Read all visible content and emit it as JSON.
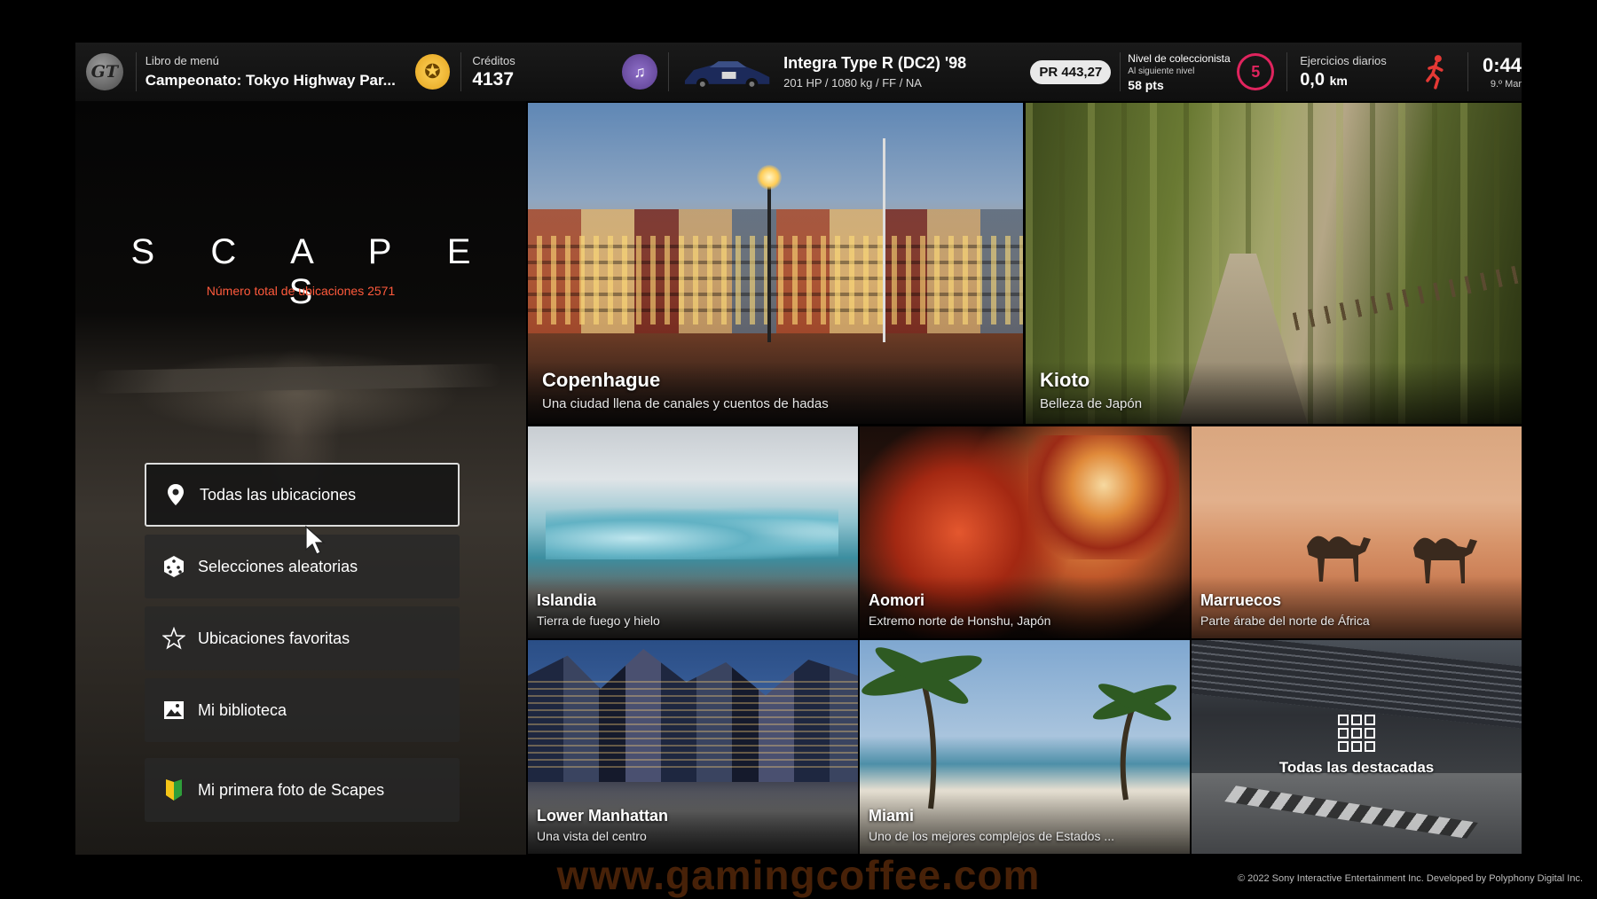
{
  "topbar": {
    "menu_label": "Libro de menú",
    "menu_value": "Campeonato: Tokyo Highway Par...",
    "credits_label": "Créditos",
    "credits_value": "4137",
    "car_name": "Integra Type R (DC2) '98",
    "car_specs": "201 HP / 1080 kg / FF / NA",
    "pr": "PR 443,27",
    "collector_label": "Nivel de coleccionista",
    "collector_sub": "Al siguiente nivel",
    "collector_pts": "58 pts",
    "collector_level": "5",
    "daily_label": "Ejercicios diarios",
    "daily_value": "0,0",
    "daily_unit": "km",
    "time": "0:44",
    "date": "9.º Mar",
    "colors": {
      "credits_icon": "#f2b632",
      "music_icon": "#7a5bb5",
      "level_ring": "#e0245e",
      "runner": "#e53935"
    }
  },
  "left": {
    "title": "S C A P E S",
    "count_label": "Número total de ubicaciones  2571",
    "accent": "#ff5a3c",
    "menu": [
      {
        "label": "Todas las ubicaciones",
        "icon": "location-pin-icon"
      },
      {
        "label": "Selecciones aleatorias",
        "icon": "dice-icon"
      },
      {
        "label": "Ubicaciones favoritas",
        "icon": "star-icon"
      },
      {
        "label": "Mi biblioteca",
        "icon": "image-icon"
      },
      {
        "label": "Mi primera foto de Scapes",
        "icon": "beginner-leaf-icon"
      }
    ]
  },
  "tiles": {
    "copenhagen": {
      "title": "Copenhague",
      "sub": "Una ciudad llena de canales y cuentos de hadas"
    },
    "kyoto": {
      "title": "Kioto",
      "sub": "Belleza de Japón"
    },
    "iceland": {
      "title": "Islandia",
      "sub": "Tierra de fuego y hielo"
    },
    "aomori": {
      "title": "Aomori",
      "sub": "Extremo norte de Honshu, Japón"
    },
    "morocco": {
      "title": "Marruecos",
      "sub": "Parte árabe del norte de África"
    },
    "manhattan": {
      "title": "Lower Manhattan",
      "sub": "Una vista del centro"
    },
    "miami": {
      "title": "Miami",
      "sub": "Uno de los mejores complejos de Estados ..."
    },
    "featured": {
      "title": "Todas las destacadas"
    }
  },
  "footer": {
    "copyright": "© 2022 Sony Interactive Entertainment Inc. Developed by Polyphony Digital Inc.",
    "watermark": "www.gamingcoffee.com"
  }
}
